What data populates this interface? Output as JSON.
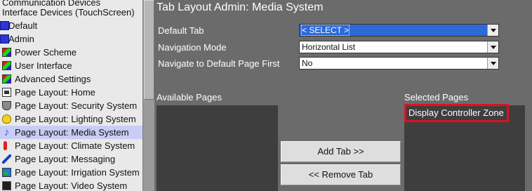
{
  "tree": {
    "items": [
      {
        "label": "Communication Devices",
        "icon": "none"
      },
      {
        "label": "Interface Devices (TouchScreen)",
        "icon": "none"
      },
      {
        "label": "Default",
        "icon": "folder-icon"
      },
      {
        "label": "Admin",
        "icon": "folder-icon"
      },
      {
        "label": "Power Scheme",
        "icon": "multi-color-icon"
      },
      {
        "label": "User Interface",
        "icon": "multi-color-icon"
      },
      {
        "label": "Advanced Settings",
        "icon": "multi-color-icon"
      },
      {
        "label": "Page Layout: Home",
        "icon": "document-icon"
      },
      {
        "label": "Page Layout: Security System",
        "icon": "shield-icon"
      },
      {
        "label": "Page Layout: Lighting System",
        "icon": "light-bulb-icon"
      },
      {
        "label": "Page Layout: Media System",
        "icon": "music-note-icon"
      },
      {
        "label": "Page Layout: Climate System",
        "icon": "thermometer-icon"
      },
      {
        "label": "Page Layout: Messaging",
        "icon": "pen-icon"
      },
      {
        "label": "Page Layout: Irrigation System",
        "icon": "sprinkler-icon"
      },
      {
        "label": "Page Layout: Video System",
        "icon": "video-icon"
      }
    ],
    "selected_label": "Page Layout: Media System"
  },
  "panel": {
    "title": "Tab Layout Admin: Media System",
    "default_tab_label": "Default Tab",
    "default_tab_value": "< SELECT >",
    "nav_mode_label": "Navigation Mode",
    "nav_mode_value": "Horizontal List",
    "nav_default_label": "Navigate to Default Page First",
    "nav_default_value": "No",
    "available_label": "Available Pages",
    "selected_label": "Selected Pages",
    "selected_pages": [
      "Display Controller Zone"
    ],
    "add_tab_label": "Add Tab >>",
    "remove_tab_label": "<< Remove Tab"
  },
  "colors": {
    "panel_bg": "#6b6b6b",
    "tree_bg": "#e9e9e9",
    "tree_selection": "#c9cdf5",
    "focused_select": "#2d6ad8",
    "highlight_border": "#e0101f"
  }
}
